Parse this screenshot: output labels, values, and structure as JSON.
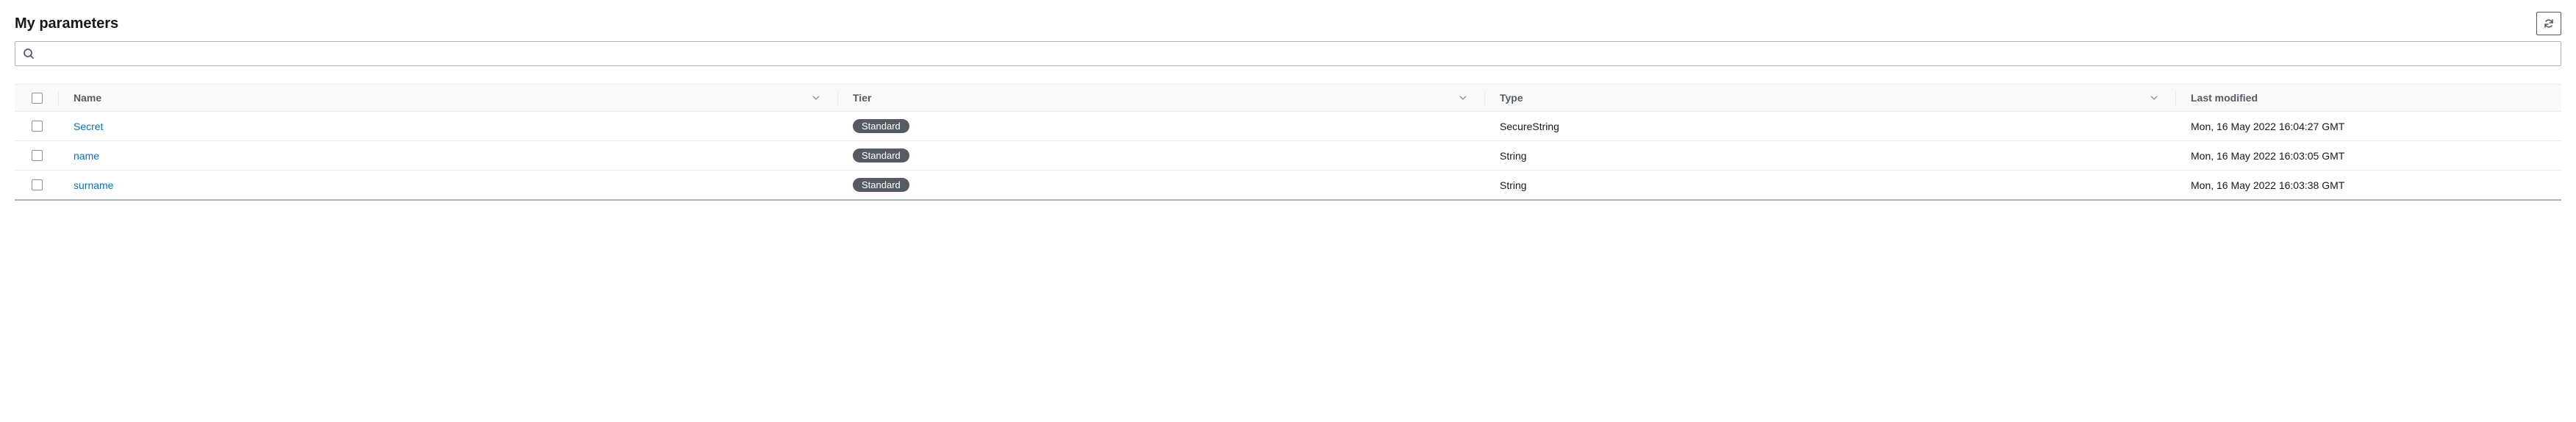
{
  "header": {
    "title": "My parameters"
  },
  "search": {
    "value": "",
    "placeholder": ""
  },
  "table": {
    "columns": {
      "name": "Name",
      "tier": "Tier",
      "type": "Type",
      "modified": "Last modified"
    },
    "rows": [
      {
        "name": "Secret",
        "tier": "Standard",
        "type": "SecureString",
        "modified": "Mon, 16 May 2022 16:04:27 GMT"
      },
      {
        "name": "name",
        "tier": "Standard",
        "type": "String",
        "modified": "Mon, 16 May 2022 16:03:05 GMT"
      },
      {
        "name": "surname",
        "tier": "Standard",
        "type": "String",
        "modified": "Mon, 16 May 2022 16:03:38 GMT"
      }
    ]
  }
}
